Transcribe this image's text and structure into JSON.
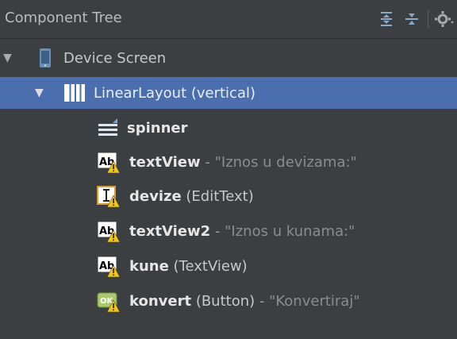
{
  "panel": {
    "title": "Component Tree",
    "tools": [
      {
        "icon": "expand-all-icon"
      },
      {
        "icon": "collapse-all-icon"
      },
      {
        "icon": "gear-dropdown-icon"
      }
    ]
  },
  "tree": {
    "device": {
      "label": "Device Screen",
      "icon": "device-icon"
    },
    "layout": {
      "label": "LinearLayout (vertical)",
      "icon": "linear-layout-icon"
    },
    "items": [
      {
        "name": "spinner",
        "type": "",
        "dash": "",
        "text": "",
        "icon": "spinner-icon"
      },
      {
        "name": "textView",
        "type": "",
        "dash": " - ",
        "text": "\"Iznos u devizama:\"",
        "icon": "textview-icon"
      },
      {
        "name": "devize",
        "type": " (EditText)",
        "dash": "",
        "text": "",
        "icon": "edittext-icon"
      },
      {
        "name": "textView2",
        "type": "",
        "dash": " - ",
        "text": "\"Iznos u kunama:\"",
        "icon": "textview-icon"
      },
      {
        "name": "kune",
        "type": " (TextView)",
        "dash": "",
        "text": "",
        "icon": "textview-icon"
      },
      {
        "name": "konvert",
        "type": " (Button)",
        "dash": " - ",
        "text": "\"Konvertiraj\"",
        "icon": "button-icon"
      }
    ]
  },
  "colors": {
    "background": "#3c3f41",
    "selection": "#4b6eaf",
    "warning": "#f0c419"
  }
}
